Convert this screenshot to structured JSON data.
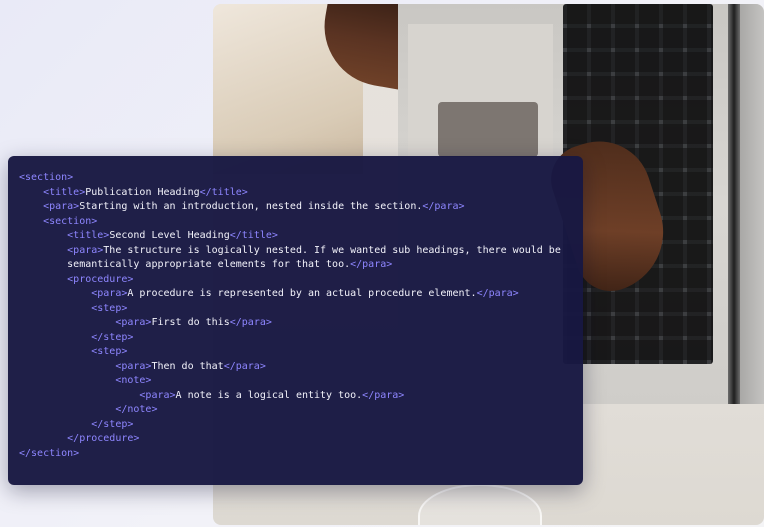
{
  "photo": {
    "subject": "hands typing on a laptop keyboard, top-down view",
    "accent_colors": {
      "code_bg": "#181842",
      "tag": "#8e86ff",
      "text": "#f2f2fa"
    }
  },
  "code_lines": [
    {
      "indent": 0,
      "open": "<section>",
      "text": "",
      "close": ""
    },
    {
      "indent": 1,
      "open": "<title>",
      "text": "Publication Heading",
      "close": "</title>"
    },
    {
      "indent": 1,
      "open": "<para>",
      "text": "Starting with an introduction, nested inside the section.",
      "close": "</para>"
    },
    {
      "indent": 1,
      "open": "<section>",
      "text": "",
      "close": ""
    },
    {
      "indent": 2,
      "open": "<title>",
      "text": "Second Level Heading",
      "close": "</title>"
    },
    {
      "indent": 2,
      "open": "<para>",
      "text": "The structure is logically nested. If we wanted sub headings, there would be",
      "close": ""
    },
    {
      "indent": 2,
      "open": "",
      "text": "semantically appropriate elements for that too.",
      "close": "</para>"
    },
    {
      "indent": 2,
      "open": "<procedure>",
      "text": "",
      "close": ""
    },
    {
      "indent": 3,
      "open": "<para>",
      "text": "A procedure is represented by an actual procedure element.",
      "close": "</para>"
    },
    {
      "indent": 3,
      "open": "<step>",
      "text": "",
      "close": ""
    },
    {
      "indent": 4,
      "open": "<para>",
      "text": "First do this",
      "close": "</para>"
    },
    {
      "indent": 3,
      "open": "</step>",
      "text": "",
      "close": ""
    },
    {
      "indent": 3,
      "open": "<step>",
      "text": "",
      "close": ""
    },
    {
      "indent": 4,
      "open": "<para>",
      "text": "Then do that",
      "close": "</para>"
    },
    {
      "indent": 4,
      "open": "<note>",
      "text": "",
      "close": ""
    },
    {
      "indent": 5,
      "open": "<para>",
      "text": "A note is a logical entity too.",
      "close": "</para>"
    },
    {
      "indent": 4,
      "open": "</note>",
      "text": "",
      "close": ""
    },
    {
      "indent": 3,
      "open": "</step>",
      "text": "",
      "close": ""
    },
    {
      "indent": 2,
      "open": "</procedure>",
      "text": "",
      "close": ""
    },
    {
      "indent": 0,
      "open": "</section>",
      "text": "",
      "close": ""
    }
  ]
}
